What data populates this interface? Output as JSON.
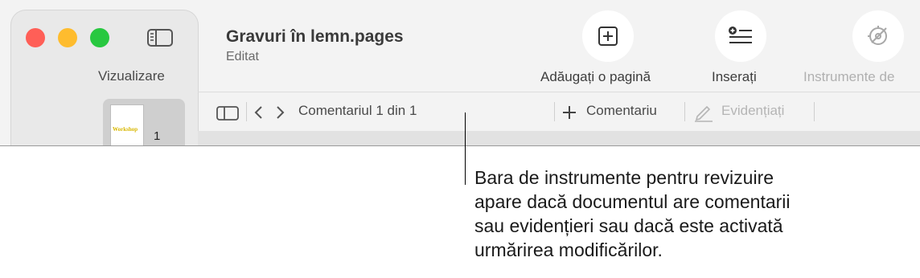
{
  "sidebar": {
    "view_label": "Vizualizare",
    "thumbnail_text": "Workshop",
    "page_number": "1"
  },
  "document": {
    "title": "Gravuri în lemn.pages",
    "status": "Editat"
  },
  "toolbar": {
    "add_page_label": "Adăugați o pagină",
    "insert_label": "Inserați",
    "tools_label": "Instrumente de"
  },
  "review_bar": {
    "comment_counter": "Comentariul 1 din 1",
    "add_comment_label": "Comentariu",
    "highlight_label": "Evidențiați"
  },
  "callout": {
    "line1": "Bara de instrumente pentru revizuire",
    "line2": "apare dacă documentul are comentarii",
    "line3": "sau evidențieri sau dacă este activată",
    "line4": "urmărirea modificărilor."
  }
}
